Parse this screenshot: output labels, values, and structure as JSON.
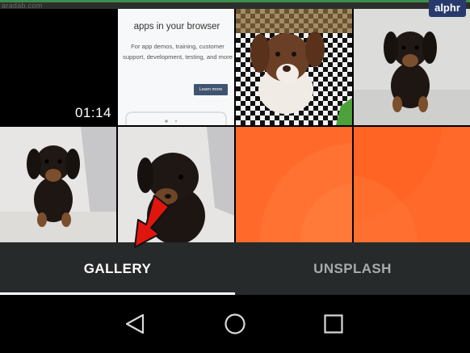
{
  "watermark": "aradab.com",
  "brand": {
    "logo": "alphr"
  },
  "grid": {
    "tiles": [
      {
        "kind": "video",
        "duration": "01:14"
      },
      {
        "kind": "promo",
        "title": "apps in your browser",
        "body": "For app demos, training, customer support, development, testing, and more",
        "button": "Learn more"
      },
      {
        "kind": "photo",
        "subject": "dachshund puppy on checkered blanket"
      },
      {
        "kind": "photo",
        "subject": "black and tan puppy sitting"
      },
      {
        "kind": "photo",
        "subject": "black and tan puppy by bed"
      },
      {
        "kind": "photo",
        "subject": "black and tan puppy close up"
      },
      {
        "kind": "gradient",
        "color": "#ff6a2b"
      },
      {
        "kind": "gradient",
        "color": "#ff6a2b"
      }
    ]
  },
  "tabs": {
    "gallery": "GALLERY",
    "unsplash": "UNSPLASH",
    "selected": "gallery"
  },
  "nav": {
    "back": "back-icon",
    "home": "home-icon",
    "recents": "recents-icon"
  },
  "colors": {
    "accent_arrow": "#e0160e",
    "tab_bar": "#272a2a",
    "orange": "#ff6a2b"
  }
}
